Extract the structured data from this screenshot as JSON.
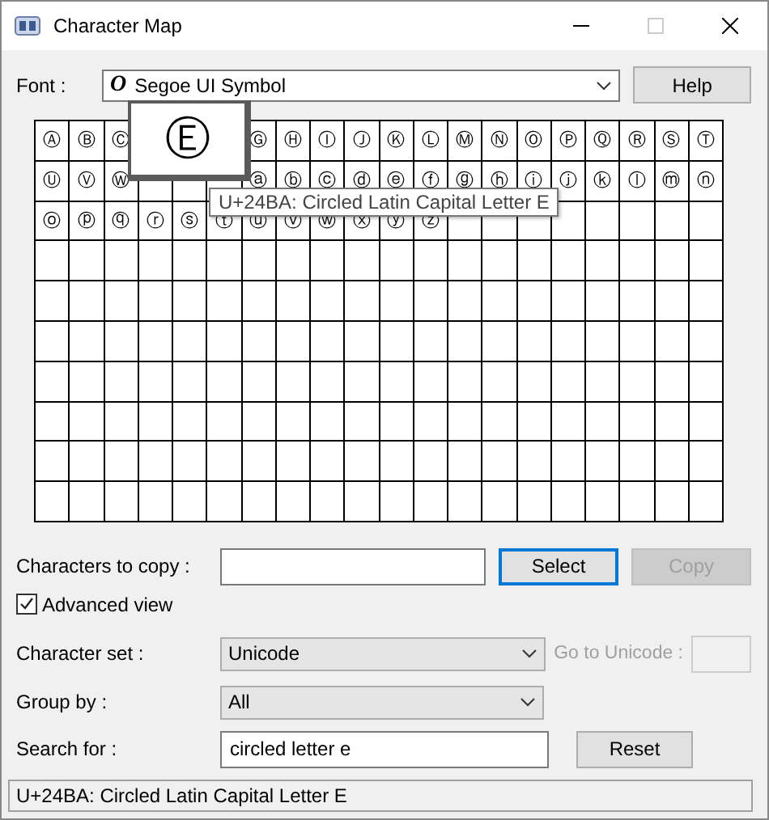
{
  "window": {
    "title": "Character Map"
  },
  "font": {
    "label": "Font :",
    "type_glyph": "O",
    "value": "Segoe UI Symbol"
  },
  "help_button": "Help",
  "grid": {
    "cells": [
      "Ⓐ",
      "Ⓑ",
      "Ⓒ",
      null,
      null,
      null,
      "Ⓖ",
      "Ⓗ",
      "Ⓘ",
      "Ⓙ",
      "Ⓚ",
      "Ⓛ",
      "Ⓜ",
      "Ⓝ",
      "Ⓞ",
      "Ⓟ",
      "Ⓠ",
      "Ⓡ",
      "Ⓢ",
      "Ⓣ",
      "Ⓤ",
      "Ⓥ",
      "Ⓦ",
      null,
      null,
      null,
      "ⓐ",
      "ⓑ",
      "ⓒ",
      "ⓓ",
      "ⓔ",
      "ⓕ",
      "ⓖ",
      "ⓗ",
      "ⓘ",
      "ⓙ",
      "ⓚ",
      "ⓛ",
      "ⓜ",
      "ⓝ",
      "ⓞ",
      "ⓟ",
      "ⓠ",
      "ⓡ",
      "ⓢ",
      "ⓣ",
      "ⓤ",
      "ⓥ",
      "ⓦ",
      "ⓧ",
      "ⓨ",
      "ⓩ"
    ]
  },
  "magnifier": {
    "char": "Ⓔ"
  },
  "tooltip": "U+24BA: Circled Latin Capital Letter E",
  "copy": {
    "label": "Characters to copy :",
    "buttons": [
      {
        "label": "Select",
        "focused": true,
        "disabled": false
      },
      {
        "label": "Copy",
        "focused": false,
        "disabled": true
      }
    ]
  },
  "advanced_view": {
    "label": "Advanced view",
    "checked": true
  },
  "character_set": {
    "label": "Character set :",
    "value": "Unicode"
  },
  "goto_unicode": {
    "label": "Go to Unicode :",
    "disabled": true
  },
  "group_by": {
    "label": "Group by :",
    "value": "All"
  },
  "search": {
    "label": "Search for :",
    "value": "circled letter e",
    "button": "Reset"
  },
  "status": "U+24BA: Circled Latin Capital Letter E"
}
